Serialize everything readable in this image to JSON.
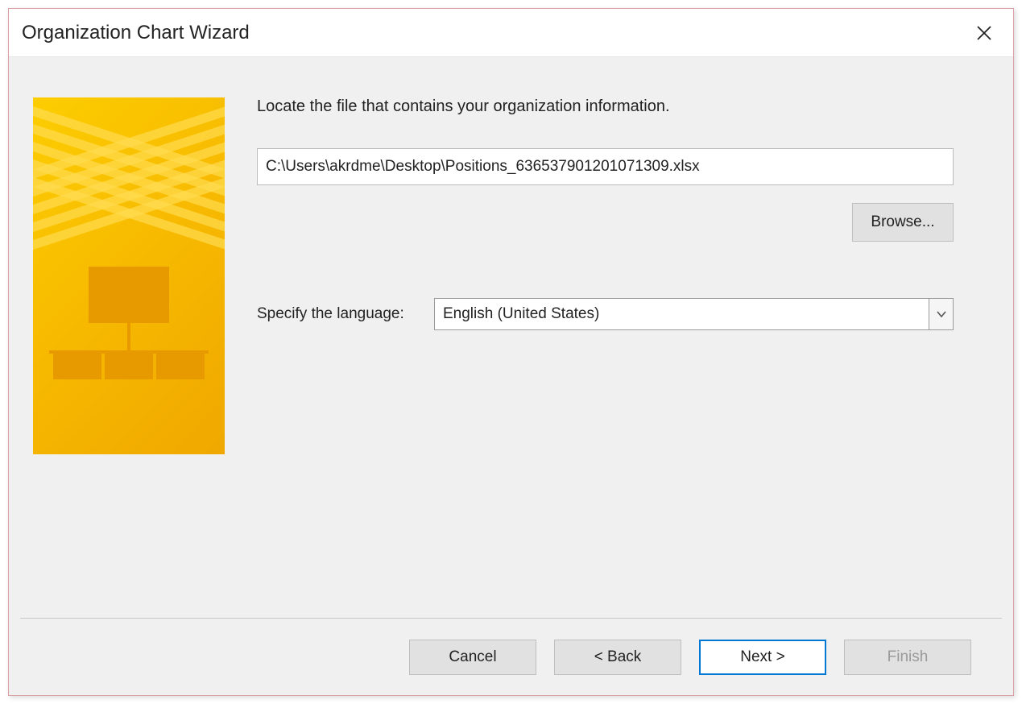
{
  "window": {
    "title": "Organization Chart Wizard"
  },
  "form": {
    "instruction": "Locate the file that contains your organization information.",
    "file_path": "C:\\Users\\akrdme\\Desktop\\Positions_636537901201071309.xlsx",
    "browse_label": "Browse...",
    "language_label": "Specify the language:",
    "language_value": "English (United States)"
  },
  "footer": {
    "cancel": "Cancel",
    "back": "< Back",
    "next": "Next >",
    "finish": "Finish"
  }
}
